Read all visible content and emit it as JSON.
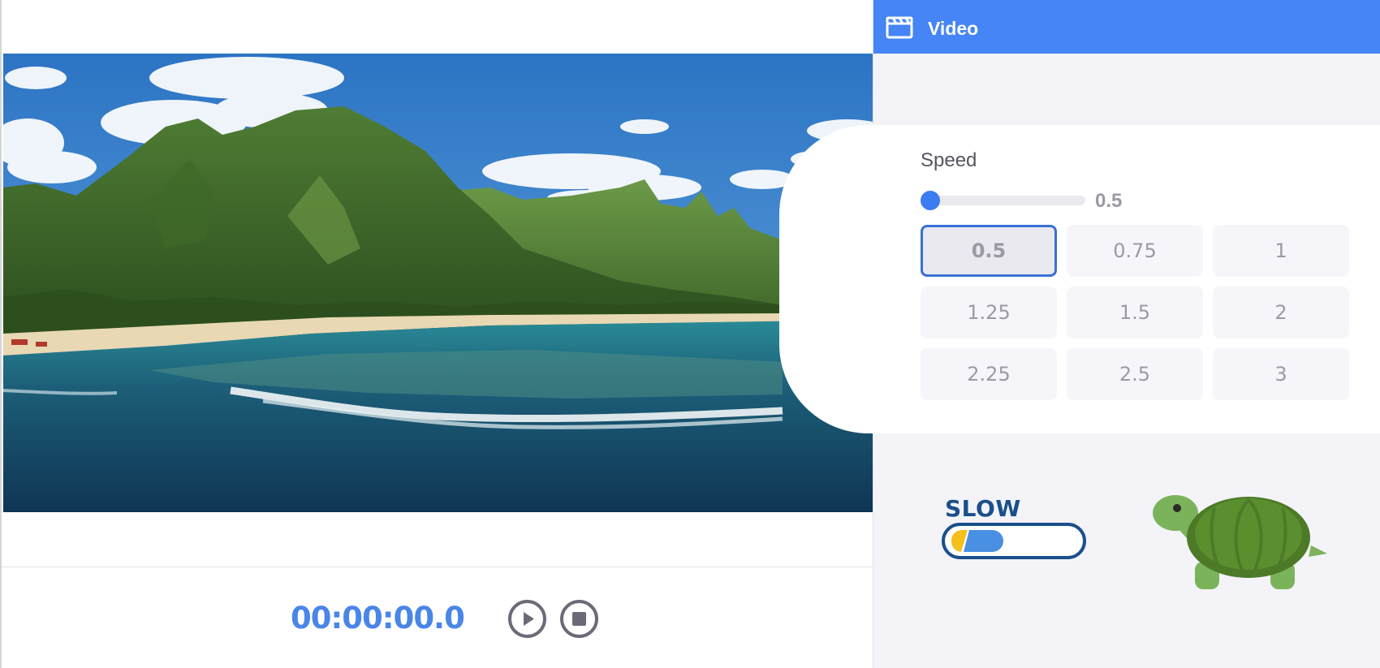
{
  "panel": {
    "title": "Video",
    "icon": "clapperboard-icon",
    "header_color": "#4585f5"
  },
  "player": {
    "timecode": "00:00:00.0",
    "play_icon": "play-icon",
    "stop_icon": "stop-icon",
    "accent_color": "#4a86e8"
  },
  "speed": {
    "label": "Speed",
    "slider_value": "0.5",
    "slider_fraction": 0.0,
    "options": [
      "0.5",
      "0.75",
      "1",
      "1.25",
      "1.5",
      "2",
      "2.25",
      "2.5",
      "3"
    ],
    "selected": "0.5"
  },
  "indicator": {
    "label": "SLOW",
    "mascot": "turtle-icon"
  }
}
